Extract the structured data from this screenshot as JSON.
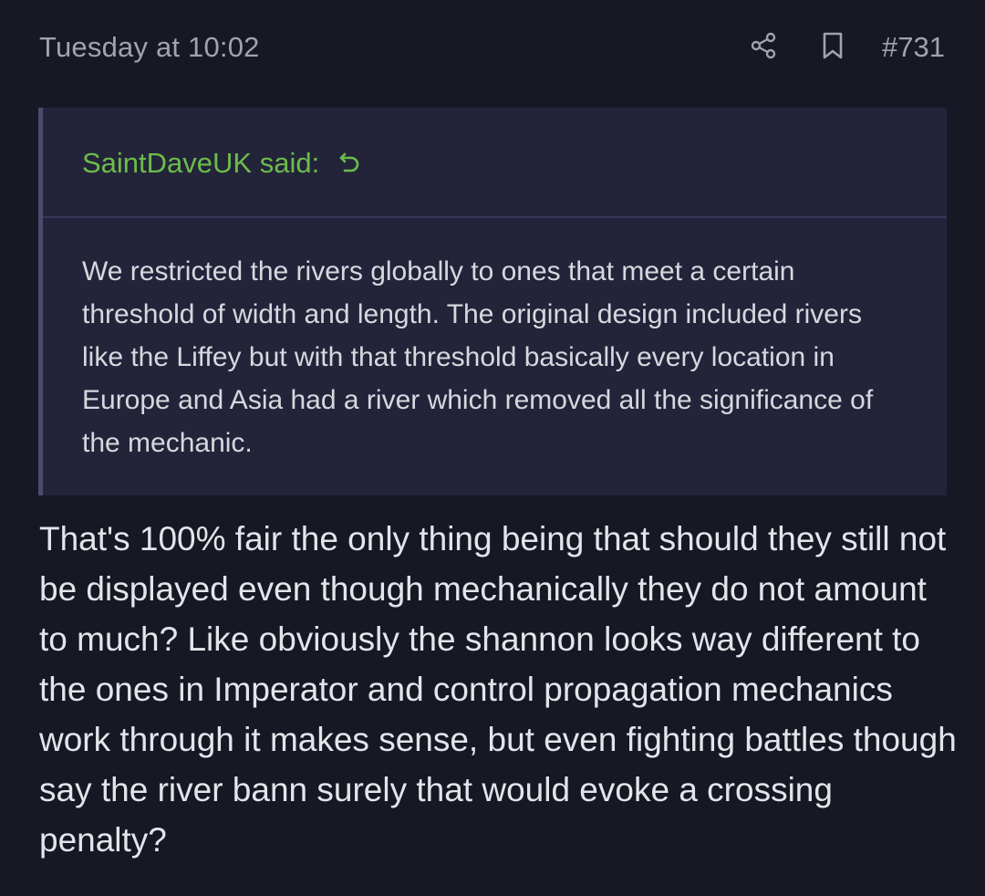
{
  "post": {
    "date": "Tuesday at 10:02",
    "number": "#731",
    "share_icon": "share-icon",
    "bookmark_icon": "bookmark-icon"
  },
  "quote": {
    "author_said": "SaintDaveUK said:",
    "jump_icon": "undo-arrow-icon",
    "accent_color": "#6dbc4a",
    "text": "We restricted the rivers globally to ones that meet a certain threshold of width and length. The original design included rivers like the Liffey but with that threshold basically every location in Europe and Asia had a river which removed all the significance of the mechanic."
  },
  "body": {
    "text": "That's 100% fair the only thing being that should they still not be displayed even though mechanically they do not amount to much? Like obviously the shannon looks way different to the ones in Imperator and control propagation mechanics work through it makes sense, but even fighting battles though say the river bann surely that would evoke a crossing penalty?"
  },
  "colors": {
    "background": "#161823",
    "quote_background": "#23243a",
    "muted_text": "#a0a3ad"
  }
}
